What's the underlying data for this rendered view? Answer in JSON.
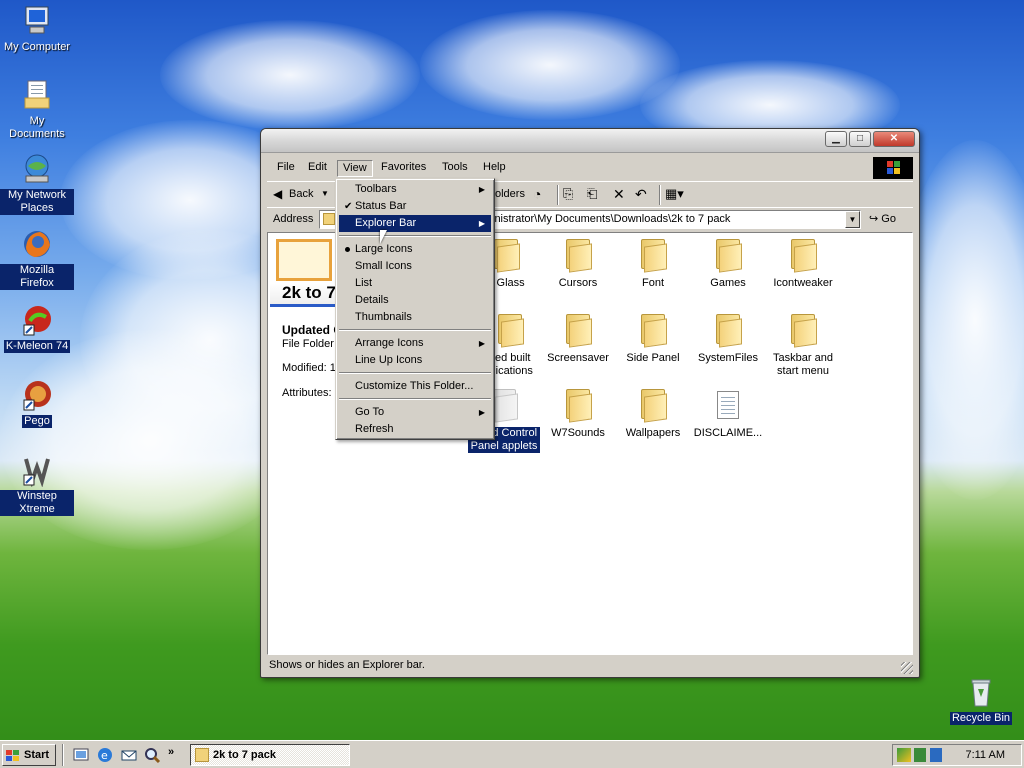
{
  "desktop": {
    "icons": [
      {
        "label": "My Computer"
      },
      {
        "label": "My Documents"
      },
      {
        "label": "My Network Places"
      },
      {
        "label": "Mozilla Firefox"
      },
      {
        "label": "K-Meleon 74"
      },
      {
        "label": "Pego"
      },
      {
        "label": "Winstep Xtreme"
      },
      {
        "label": "Recycle Bin"
      }
    ]
  },
  "window": {
    "controls": {
      "minimize": "▁",
      "maximize": "□",
      "close": "✕"
    },
    "menubar": [
      "File",
      "Edit",
      "View",
      "Favorites",
      "Tools",
      "Help"
    ],
    "toolbar": {
      "back": "Back",
      "folders": "olders",
      "go": "Go"
    },
    "address": {
      "label": "Address",
      "path": "inistrator\\My Documents\\Downloads\\2k to 7 pack"
    },
    "left_pane": {
      "title": "2k to 7",
      "item_name": "Updated C",
      "item_type": "File Folder",
      "modified": "Modified: 12",
      "attributes": "Attributes:"
    },
    "files": [
      {
        "label": "o Glass"
      },
      {
        "label": "Cursors"
      },
      {
        "label": "Font"
      },
      {
        "label": "Games"
      },
      {
        "label": "Icontweaker"
      },
      {
        "label": "fied built plications"
      },
      {
        "label": "Screensaver"
      },
      {
        "label": "Side Panel"
      },
      {
        "label": "SystemFiles"
      },
      {
        "label": "Taskbar and start menu"
      },
      {
        "label": "dated Control Panel applets"
      },
      {
        "label": "W7Sounds"
      },
      {
        "label": "Wallpapers"
      },
      {
        "label": "DISCLAIME..."
      }
    ],
    "status_text": "Shows or hides an Explorer bar."
  },
  "view_menu": {
    "items": [
      "Toolbars",
      "Status Bar",
      "Explorer Bar",
      "Large Icons",
      "Small Icons",
      "List",
      "Details",
      "Thumbnails",
      "Arrange Icons",
      "Line Up Icons",
      "Customize This Folder...",
      "Go To",
      "Refresh"
    ]
  },
  "taskbar": {
    "start_label": "Start",
    "task_label": "2k to 7 pack",
    "clock": "7:11 AM",
    "quicklaunch_more": "»"
  },
  "colors": {
    "selection": "#0a246a",
    "face": "#d4d0c8"
  }
}
